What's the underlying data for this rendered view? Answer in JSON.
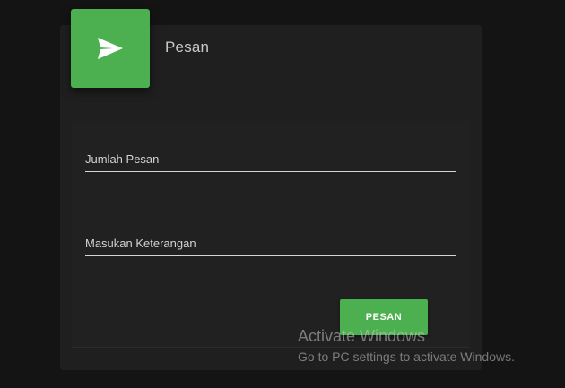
{
  "card": {
    "title": "Pesan",
    "icon": "send-icon",
    "accent_color": "#4caf50"
  },
  "form": {
    "jumlah_pesan": {
      "placeholder": "Jumlah Pesan",
      "value": ""
    },
    "keterangan": {
      "placeholder": "Masukan Keterangan",
      "value": ""
    },
    "submit_label": "PESAN"
  },
  "watermark": {
    "title": "Activate Windows",
    "subtitle": "Go to PC settings to activate Windows."
  }
}
